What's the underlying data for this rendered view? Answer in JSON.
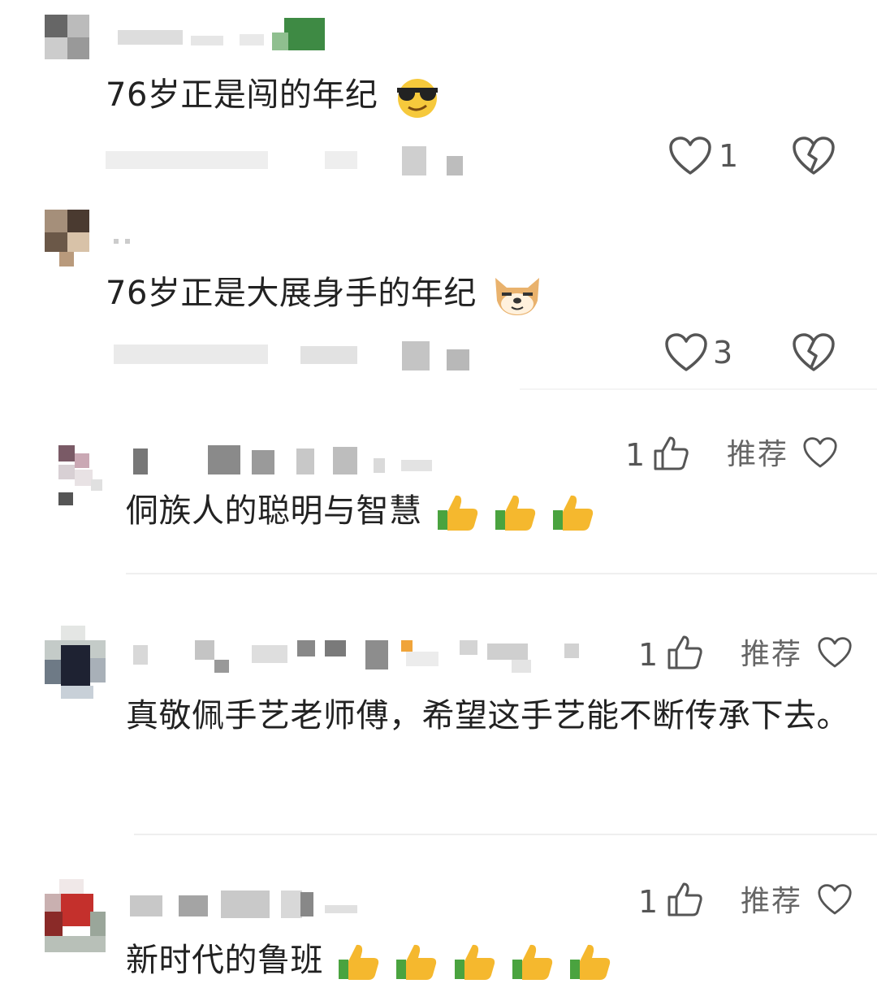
{
  "comments_style_a": [
    {
      "text": "76岁正是闯的年纪",
      "emoji": "sunglasses-emoji",
      "likes": "1"
    },
    {
      "text": "76岁正是大展身手的年纪",
      "emoji": "doge-emoji",
      "likes": "3"
    }
  ],
  "comments_style_b": [
    {
      "text": "侗族人的聪明与智慧",
      "emoji": "thumbs-up-emoji",
      "emoji_count": 3,
      "likes": "1",
      "recommend_label": "推荐"
    },
    {
      "text": "真敬佩手艺老师傅，希望这手艺能不断传承下去。",
      "likes": "1",
      "recommend_label": "推荐"
    },
    {
      "text": "新时代的鲁班",
      "emoji": "thumbs-up-emoji",
      "emoji_count": 5,
      "likes": "1",
      "recommend_label": "推荐"
    }
  ],
  "colors": {
    "text": "#222222",
    "muted": "#666666",
    "icon": "#555555",
    "divider": "#efefef"
  }
}
